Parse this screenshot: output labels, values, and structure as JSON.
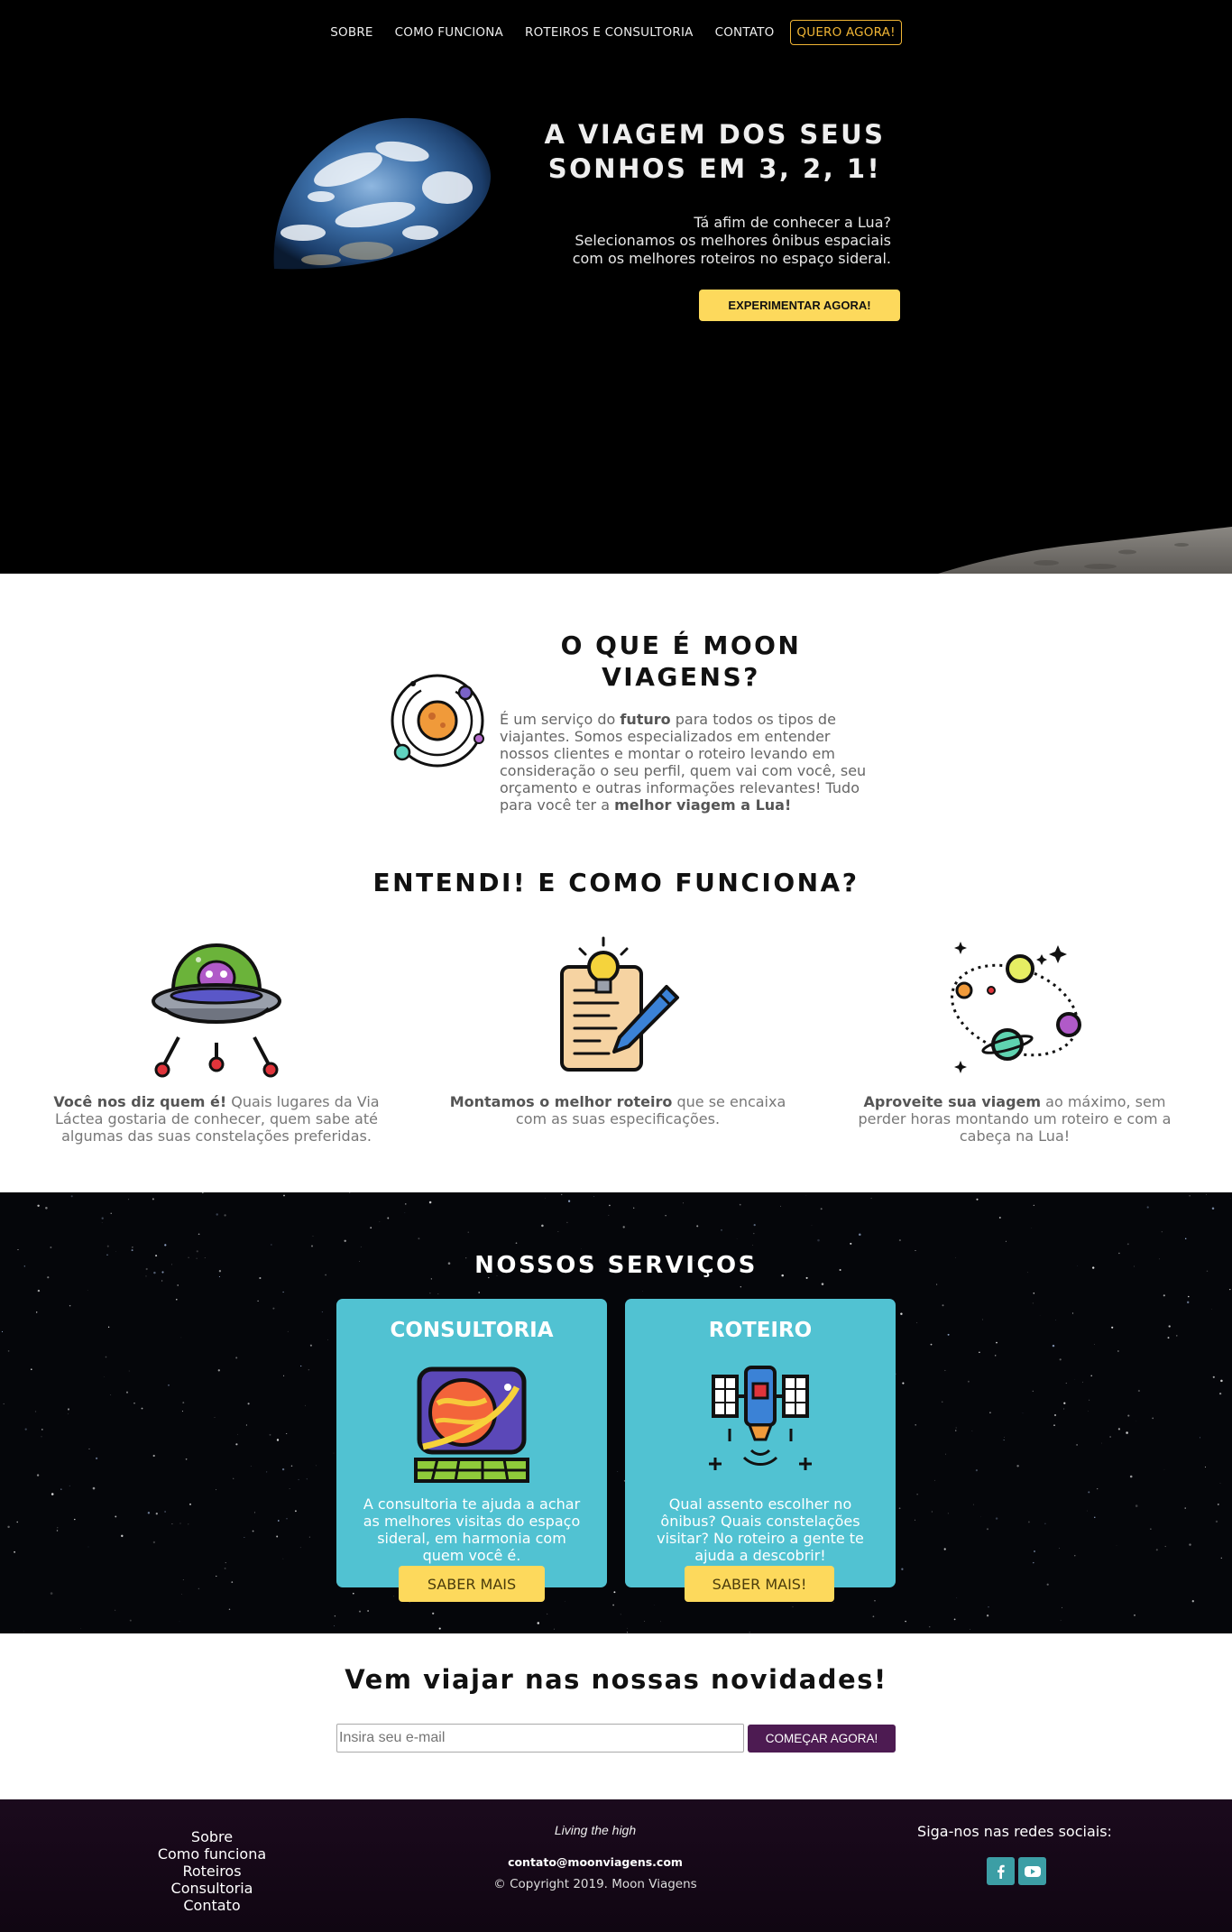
{
  "nav": {
    "items": [
      "SOBRE",
      "COMO FUNCIONA",
      "ROTEIROS E CONSULTORIA",
      "CONTATO"
    ],
    "cta": "QUERO AGORA!"
  },
  "hero": {
    "title_line1": "A VIAGEM DOS SEUS",
    "title_line2": "SONHOS EM 3, 2, 1!",
    "text_line1": "Tá afim de conhecer a Lua?",
    "text_line2": "Selecionamos os melhores ônibus espaciais",
    "text_line3": "com os melhores roteiros no espaço sideral.",
    "button": "EXPERIMENTAR AGORA!"
  },
  "about": {
    "title_line1": "O QUE É MOON",
    "title_line2": "VIAGENS?",
    "text_1": "É um serviço do ",
    "text_bold_1": "futuro",
    "text_2": " para todos os tipos de viajantes. Somos especializados em entender nossos clientes e montar o roteiro levando em consideração o seu perfil, quem vai com você, seu orçamento e outras informações relevantes! Tudo para você ter a ",
    "text_bold_2": "melhor viagem a Lua!"
  },
  "how": {
    "title": "ENTENDI! E COMO FUNCIONA?",
    "steps": [
      {
        "bold": "Você nos diz quem é!",
        "text": " Quais lugares da Via Láctea gostaria de conhecer, quem sabe até algumas das suas constelações preferidas.",
        "icon": "ufo-alien-icon"
      },
      {
        "bold": "Montamos o melhor roteiro",
        "text": " que se encaixa com as suas especificações.",
        "icon": "idea-writing-icon"
      },
      {
        "bold": "Aproveite sua viagem",
        "text": " ao máximo, sem perder horas montando um roteiro e com a cabeça na Lua!",
        "icon": "planets-orbit-icon"
      }
    ]
  },
  "services": {
    "title": "NOSSOS SERVIÇOS",
    "cards": [
      {
        "title": "CONSULTORIA",
        "text": "A consultoria te ajuda a achar as melhores visitas do espaço sideral, em harmonia com quem você é.",
        "button": "SABER MAIS",
        "icon": "planet-monitor-icon"
      },
      {
        "title": "ROTEIRO",
        "text": "Qual assento escolher no ônibus? Quais constelações visitar? No roteiro a gente te ajuda a descobrir!",
        "button": "SABER MAIS!",
        "icon": "satellite-icon"
      }
    ]
  },
  "newsletter": {
    "title": "Vem viajar nas nossas novidades!",
    "placeholder": "Insira seu e-mail",
    "button": "COMEÇAR AGORA!"
  },
  "footer": {
    "links": [
      "Sobre",
      "Como funciona",
      "Roteiros",
      "Consultoria",
      "Contato"
    ],
    "tagline": "Living the high",
    "email": "contato@moonviagens.com",
    "copyright": "© Copyright 2019. Moon Viagens",
    "social_label": "Siga-nos nas redes sociais:",
    "social": [
      "facebook-icon",
      "youtube-icon"
    ]
  },
  "colors": {
    "accent_yellow": "#fdd95c",
    "nav_cta": "#f0b535",
    "card_teal": "#51c2d2",
    "newsletter_button": "#4d1b52",
    "social_teal": "#3c9ea5"
  }
}
